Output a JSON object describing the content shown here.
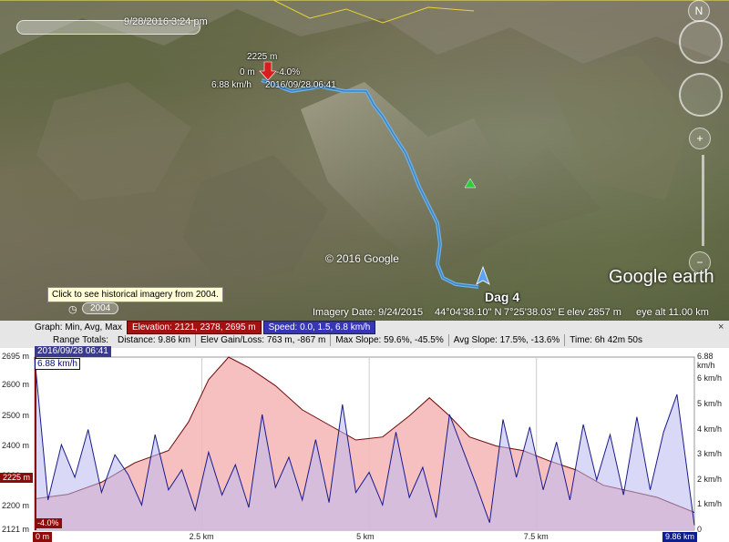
{
  "map": {
    "time_label": "9/28/2016    3:24 pm",
    "marker": {
      "elev": "2225 m",
      "dist": "0 m",
      "slope": "-4.0%",
      "speed": "6.88 km/h",
      "time": "2016/09/28 06:41"
    },
    "copyright": "© 2016 Google",
    "logo": "Google earth",
    "placemark": "Dag 4",
    "tooltip": "Click to see historical imagery from 2004.",
    "historical_button": "2004",
    "status": {
      "imagery_date": "Imagery Date: 9/24/2015",
      "lat": "44°04'38.10\" N",
      "lon": "7°25'38.03\" E",
      "elev": "elev  2857 m",
      "eye_alt": "eye alt  11.00 km"
    }
  },
  "profile": {
    "graph_label": "Graph: Min, Avg, Max",
    "elevation_chip": "Elevation: 2121, 2378, 2695 m",
    "speed_chip": "Speed: 0.0, 1.5, 6.8 km/h",
    "range_totals": "Range Totals:",
    "distance": "Distance: 9.86 km",
    "elev_gain": "Elev Gain/Loss: 763 m, -867 m",
    "max_slope": "Max Slope: 59.6%, -45.5%",
    "avg_slope": "Avg Slope: 17.5%, -13.6%",
    "time": "Time: 6h 42m 50s",
    "close": "×",
    "cursor_date": "2016/09/28 06:41",
    "cursor_speed": "6.88 km/h",
    "cursor_elev": "2225 m",
    "cursor_slope": "-4.0%",
    "cursor_dist": "0 m",
    "end_dist": "9.86 km",
    "colors": {
      "elevation": "#f5b5b5",
      "speed_line": "#1a1a8c",
      "speed_fill": "#b9b9f0",
      "elev_line": "#6e0a0a"
    }
  },
  "chart_data": {
    "type": "area",
    "x_unit": "km",
    "xlim": [
      0,
      9.86
    ],
    "x_ticks": [
      "2.5 km",
      "5 km",
      "7.5 km"
    ],
    "y_left_ticks": [
      "2695 m",
      "2600 m",
      "2500 m",
      "2400 m",
      "2300 m",
      "2200 m",
      "2121 m"
    ],
    "y_right_ticks": [
      "6.88 km/h",
      "6 km/h",
      "5 km/h",
      "4 km/h",
      "3 km/h",
      "2 km/h",
      "1 km/h",
      "0"
    ],
    "ylim_left": [
      2121,
      2695
    ],
    "ylim_right": [
      0,
      6.88
    ],
    "series": [
      {
        "name": "Elevation",
        "x": [
          0,
          0.5,
          1.0,
          1.5,
          2.0,
          2.3,
          2.6,
          2.9,
          3.2,
          3.6,
          4.0,
          4.4,
          4.8,
          5.2,
          5.6,
          5.9,
          6.2,
          6.5,
          6.9,
          7.3,
          7.7,
          8.1,
          8.5,
          8.9,
          9.3,
          9.86
        ],
        "values": [
          2225,
          2240,
          2280,
          2345,
          2385,
          2480,
          2620,
          2695,
          2660,
          2600,
          2520,
          2470,
          2420,
          2430,
          2500,
          2560,
          2500,
          2430,
          2400,
          2385,
          2350,
          2320,
          2270,
          2250,
          2230,
          2180
        ]
      },
      {
        "name": "Speed",
        "x": [
          0,
          0.2,
          0.4,
          0.6,
          0.8,
          1.0,
          1.2,
          1.4,
          1.6,
          1.8,
          2.0,
          2.2,
          2.4,
          2.6,
          2.8,
          3.0,
          3.2,
          3.4,
          3.6,
          3.8,
          4.0,
          4.2,
          4.4,
          4.6,
          4.8,
          5.0,
          5.2,
          5.4,
          5.6,
          5.8,
          6.0,
          6.2,
          6.4,
          6.6,
          6.8,
          7.0,
          7.2,
          7.4,
          7.6,
          7.8,
          8.0,
          8.2,
          8.4,
          8.6,
          8.8,
          9.0,
          9.2,
          9.4,
          9.6,
          9.86
        ],
        "values": [
          6.88,
          1.2,
          3.4,
          2.1,
          4.0,
          1.5,
          3.0,
          2.2,
          1.0,
          3.8,
          1.6,
          2.4,
          0.8,
          3.1,
          1.4,
          2.6,
          0.9,
          4.6,
          1.7,
          2.9,
          1.2,
          3.6,
          1.1,
          5.0,
          1.5,
          2.3,
          1.0,
          3.9,
          1.3,
          2.5,
          0.5,
          4.6,
          3.2,
          1.8,
          0.3,
          4.4,
          2.1,
          4.1,
          1.6,
          3.5,
          1.2,
          4.2,
          2.0,
          3.8,
          1.4,
          4.5,
          1.6,
          3.9,
          5.4,
          0.2
        ]
      }
    ]
  }
}
